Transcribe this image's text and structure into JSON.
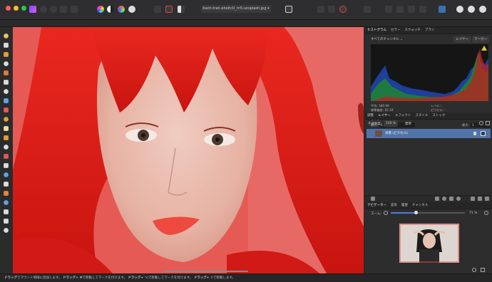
{
  "toolbar": {
    "filename": "bach-tran-ehoitcU_m5-unsplash.jpg",
    "filename_dropdown": "▾"
  },
  "tools": [
    "hand-icon",
    "move-icon",
    "pen-icon",
    "crop-icon",
    "brush-icon",
    "selection-icon",
    "lasso-icon",
    "fill-icon",
    "color-picker-icon",
    "paint-icon",
    "eraser-icon",
    "dodge-icon",
    "clone-icon",
    "stamp-icon",
    "smudge-icon",
    "blur-icon",
    "sharpen-icon",
    "gradient-icon",
    "rect-shape-icon",
    "text-icon",
    "zoom-icon",
    "view-icon"
  ],
  "histogram_panel": {
    "tabs": [
      "ヒストグラム",
      "カラー",
      "スウォッチ",
      "ブラシ"
    ],
    "channel_label": "すべてのチャンネル ⌄",
    "layer_btn": "レイヤー",
    "marker_btn": "マーカー",
    "warning_icon": "warning-icon",
    "stats_left": [
      "平均: 180.69",
      "標準偏差: 65.19",
      "中央値: 197",
      "ピクセル: 230368"
    ],
    "stats_right": [
      "レベル: -",
      "ピクセル: -",
      "パーセンタイル: -"
    ],
    "min_label": "最小:",
    "min_value": "0",
    "max_label": "最大:",
    "max_value": "1"
  },
  "layers_panel": {
    "tabs": [
      "調整",
      "レイヤー",
      "エフェクト",
      "スタイル",
      "ストック"
    ],
    "opacity_label": "不透明度:",
    "opacity_value": "100 %",
    "blend_mode": "標準",
    "layer_name": "背景 (ピクセル)"
  },
  "navigator_panel": {
    "tabs": [
      "ナビゲーター",
      "変形",
      "履歴",
      "チャンネル"
    ],
    "zoom_label": "ズーム:",
    "zoom_value": "71 %",
    "zoom_fraction": 0.34
  },
  "status": {
    "text_1": "ドラッグ",
    "text_2": "でマウント領域に追加します。",
    "text_3": "ドラッグ+ ⌘",
    "text_4": "で移動してマークを付けます。",
    "text_5": "ドラッグ+ ⌥",
    "text_6": "で移動してマークを付けます。",
    "text_7": "ドラッグ+ ⇧",
    "text_8": "で移動します。"
  },
  "colors": {
    "accent_blue": "#5174a8",
    "hair_red": "#e3201c",
    "background": "#2a2a2b"
  }
}
